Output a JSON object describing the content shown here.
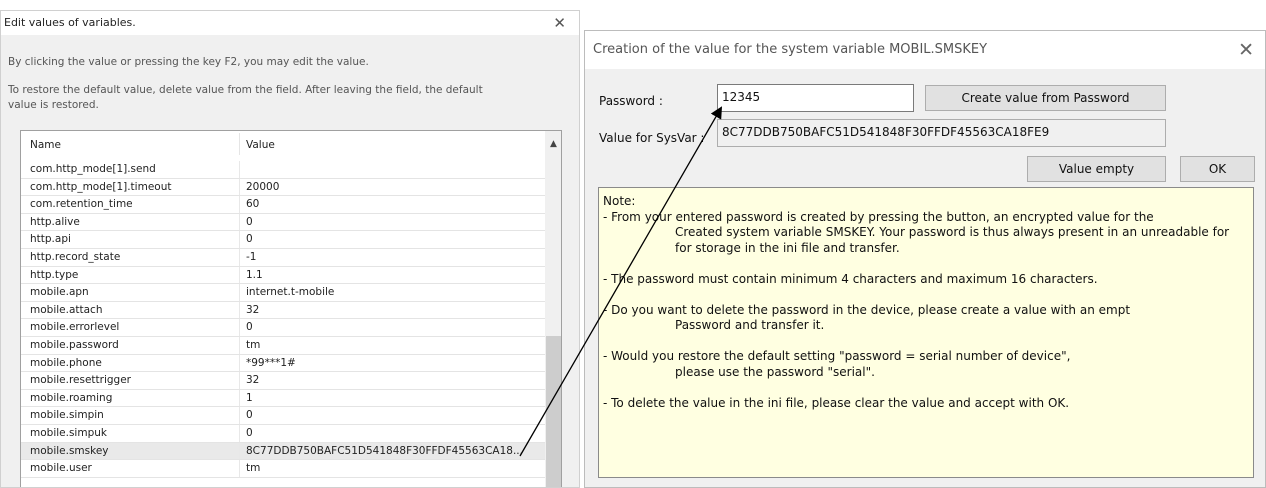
{
  "left_dialog": {
    "title": "Edit values of variables.",
    "close_glyph": "✕",
    "instruction_1": "By clicking the value or pressing the key F2, you may edit the value.",
    "instruction_2": "To restore the default value, delete value from the field. After leaving the field, the default value is restored.",
    "table": {
      "columns": [
        "Name",
        "Value"
      ],
      "scroll_up_glyph": "▲",
      "rows": [
        {
          "name": "com.http_mode[1].send",
          "value": ""
        },
        {
          "name": "com.http_mode[1].timeout",
          "value": "20000"
        },
        {
          "name": "com.retention_time",
          "value": "60"
        },
        {
          "name": "http.alive",
          "value": "0"
        },
        {
          "name": "http.api",
          "value": "0"
        },
        {
          "name": "http.record_state",
          "value": "-1"
        },
        {
          "name": "http.type",
          "value": "1.1"
        },
        {
          "name": "mobile.apn",
          "value": "internet.t-mobile"
        },
        {
          "name": "mobile.attach",
          "value": "32"
        },
        {
          "name": "mobile.errorlevel",
          "value": "0"
        },
        {
          "name": "mobile.password",
          "value": "tm"
        },
        {
          "name": "mobile.phone",
          "value": "*99***1#"
        },
        {
          "name": "mobile.resettrigger",
          "value": "32"
        },
        {
          "name": "mobile.roaming",
          "value": "1"
        },
        {
          "name": "mobile.simpin",
          "value": "0"
        },
        {
          "name": "mobile.simpuk",
          "value": "0"
        },
        {
          "name": "mobile.smskey",
          "value": "8C77DDB750BAFC51D541848F30FFDF45563CA18..."
        },
        {
          "name": "mobile.user",
          "value": "tm"
        }
      ]
    }
  },
  "right_dialog": {
    "title": "Creation of the value for the system variable MOBIL.SMSKEY",
    "close_glyph": "✕",
    "password_label": "Password :",
    "password_value": "12345",
    "create_button": "Create value from Password",
    "sysvar_label": "Value for SysVar :",
    "sysvar_value": "8C77DDB750BAFC51D541848F30FFDF45563CA18FE9",
    "empty_button": "Value empty",
    "ok_button": "OK",
    "note": {
      "heading": "Note:",
      "p1_line1": "- From your entered password is created by pressing the button, an encrypted value for the",
      "p1_line2": "Created system variable SMSKEY. Your password is thus always present in an unreadable for",
      "p1_line3": "for storage in the ini file and transfer.",
      "p2": "- The password must contain minimum 4 characters and maximum 16 characters.",
      "p3_line1": "- Do you want to delete the password in the device, please create a value with an empt",
      "p3_line2": "Password and transfer it.",
      "p4_line1": "- Would you restore the default setting \"password = serial number of device\",",
      "p4_line2": "please use the password \"serial\".",
      "p5": "- To delete the value in the ini file, please clear the value and accept with OK."
    }
  },
  "arrow_color": "#000000"
}
